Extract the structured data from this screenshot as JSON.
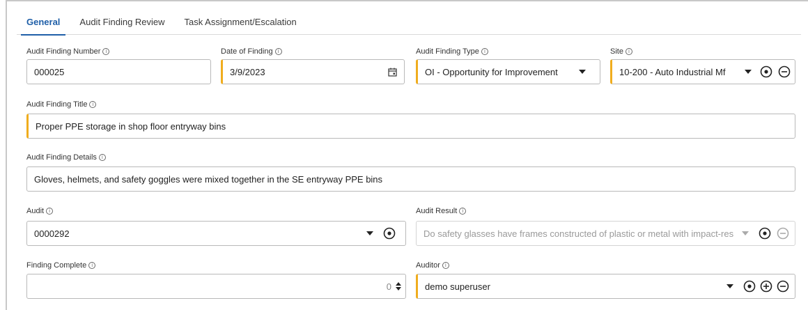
{
  "tabs": [
    {
      "label": "General"
    },
    {
      "label": "Audit Finding Review"
    },
    {
      "label": "Task Assignment/Escalation"
    }
  ],
  "form": {
    "audit_finding_number": {
      "label": "Audit Finding Number",
      "value": "000025"
    },
    "date_of_finding": {
      "label": "Date of Finding",
      "value": "3/9/2023"
    },
    "audit_finding_type": {
      "label": "Audit Finding Type",
      "value": "OI - Opportunity for Improvement"
    },
    "site": {
      "label": "Site",
      "value": "10-200 - Auto Industrial Mf"
    },
    "audit_finding_title": {
      "label": "Audit Finding Title",
      "value": "Proper PPE storage in shop floor entryway bins"
    },
    "audit_finding_details": {
      "label": "Audit Finding Details",
      "value": "Gloves, helmets, and safety goggles were mixed together in the SE entryway PPE bins"
    },
    "audit": {
      "label": "Audit",
      "value": "0000292"
    },
    "audit_result": {
      "label": "Audit Result",
      "value": "Do safety glasses have frames constructed of plastic or metal with impact-res"
    },
    "finding_complete": {
      "label": "Finding Complete",
      "value": "0"
    },
    "auditor": {
      "label": "Auditor",
      "value": "demo superuser"
    }
  },
  "colors": {
    "accent": "#1f5fa8",
    "required_marker": "#f0ad1e",
    "border": "#b9b9b9"
  }
}
